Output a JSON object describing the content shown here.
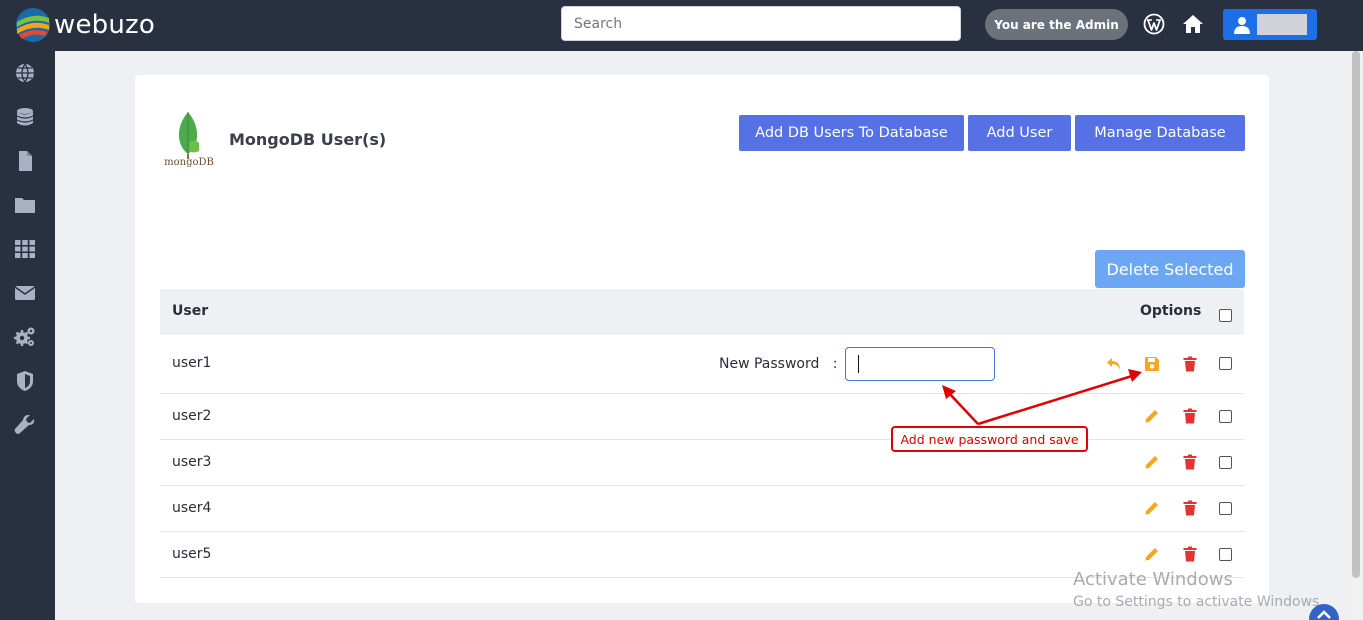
{
  "header": {
    "logo_text": "webuzo",
    "search_placeholder": "Search",
    "admin_badge": "You are the Admin"
  },
  "sidebar": {
    "items": [
      {
        "icon": "globe-icon"
      },
      {
        "icon": "database-icon"
      },
      {
        "icon": "file-icon"
      },
      {
        "icon": "folder-icon"
      },
      {
        "icon": "apps-grid-icon"
      },
      {
        "icon": "mail-icon"
      },
      {
        "icon": "gears-icon"
      },
      {
        "icon": "shield-icon"
      },
      {
        "icon": "wrench-icon"
      }
    ]
  },
  "page": {
    "logo_label": "mongoDB",
    "title": "MongoDB User(s)",
    "buttons": {
      "add_db_users": "Add DB Users To Database",
      "add_user": "Add User",
      "manage_database": "Manage Database",
      "delete_selected": "Delete Selected"
    }
  },
  "table": {
    "headers": {
      "user": "User",
      "options": "Options"
    },
    "rows": [
      {
        "user": "user1",
        "editing": true
      },
      {
        "user": "user2",
        "editing": false
      },
      {
        "user": "user3",
        "editing": false
      },
      {
        "user": "user4",
        "editing": false
      },
      {
        "user": "user5",
        "editing": false
      }
    ],
    "new_password_label": "New Password",
    "new_password_separator": ":",
    "new_password_value": ""
  },
  "annotation": {
    "text": "Add new password and save",
    "color": "#e00000"
  },
  "watermark": {
    "line1": "Activate Windows",
    "line2": "Go to Settings to activate Windows."
  },
  "colors": {
    "topbar": "#293040",
    "primary_button": "#5670e6",
    "delete_selected_button": "#6ba7f3",
    "user_button": "#1e6ee6",
    "edit_icon": "#f5a623",
    "delete_icon": "#e8322f"
  }
}
